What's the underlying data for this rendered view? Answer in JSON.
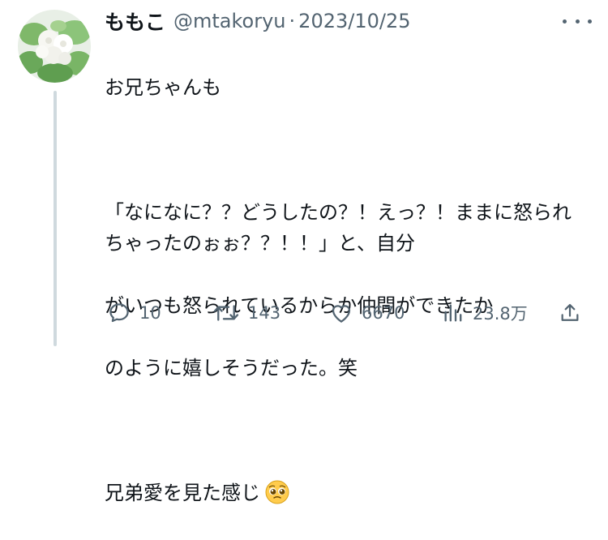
{
  "tweet": {
    "display_name": "ももこ",
    "handle": "@mtakoryu",
    "separator": "·",
    "date": "2023/10/25",
    "text_lines": [
      "お兄ちゃんも",
      "",
      "「なになに？？どうしたの？！えっ？！ままに怒られちゃったのぉぉ？？！！」と、自分",
      "がいつも怒られているからか仲間ができたか",
      "のように嬉しそうだった。笑",
      "",
      "兄弟愛を見た感じ"
    ],
    "emoji": "pleading-face"
  },
  "actions": {
    "replies": "10",
    "retweets": "143",
    "likes": "6670",
    "views": "23.8万"
  },
  "colors": {
    "text": "#0f1419",
    "secondary": "#536471",
    "thread_line": "#cfd9de"
  }
}
